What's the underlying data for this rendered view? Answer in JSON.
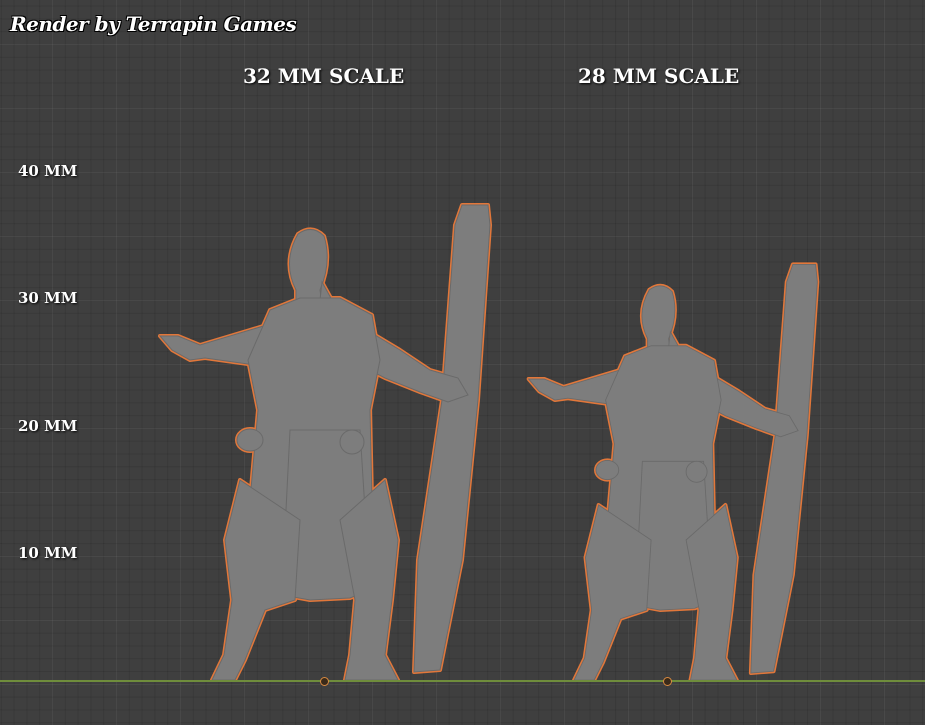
{
  "credit": "Render by Terrapin Games",
  "scale_labels": {
    "left": "32 MM SCALE",
    "right": "28 MM SCALE"
  },
  "height_ticks": {
    "t40": "40 MM",
    "t30": "30 MM",
    "t20": "20 MM",
    "t10": "10 MM"
  },
  "colors": {
    "background": "#3f3f3f",
    "grid": "#4a4a4a",
    "ground": "#6f8d3c",
    "model": "#7d7d7d",
    "outline": "#e2773a"
  },
  "figures": [
    {
      "scale": "32 MM SCALE",
      "subject": "monk-with-staff"
    },
    {
      "scale": "28 MM SCALE",
      "subject": "monk-with-staff"
    }
  ]
}
